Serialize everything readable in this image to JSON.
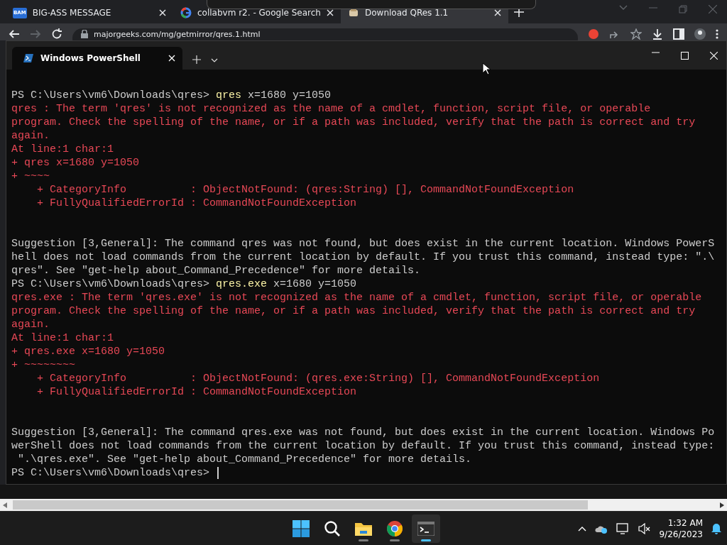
{
  "browser": {
    "tabs": [
      {
        "favicon_text": "BAM",
        "kind": "bam",
        "title": "BIG-ASS MESSAGE",
        "selected": false
      },
      {
        "kind": "google",
        "title": "collabvm r2. - Google Search",
        "selected": false
      },
      {
        "kind": "archive",
        "title": "Download QRes 1.1",
        "selected": true
      }
    ],
    "address": "majorgeeks.com/mg/getmirror/qres.1.html"
  },
  "terminal": {
    "tabs": [
      {
        "title": "Windows PowerShell",
        "selected": true
      }
    ],
    "lines": [
      {
        "kind": "text",
        "segments": [
          {
            "kind": "prompt",
            "text": "PS C:\\Users\\vm6\\Downloads\\qres> "
          },
          {
            "kind": "command",
            "text": "qres"
          },
          {
            "kind": "arg",
            "text": " x=1680 y=1050"
          }
        ]
      },
      {
        "kind": "text",
        "segments": [
          {
            "kind": "error",
            "text": "qres : The term 'qres' is not recognized as the name of a cmdlet, function, script file, or operable"
          }
        ]
      },
      {
        "kind": "text",
        "segments": [
          {
            "kind": "error",
            "text": "program. Check the spelling of the name, or if a path was included, verify that the path is correct and try"
          }
        ]
      },
      {
        "kind": "text",
        "segments": [
          {
            "kind": "error",
            "text": "again."
          }
        ]
      },
      {
        "kind": "text",
        "segments": [
          {
            "kind": "error",
            "text": "At line:1 char:1"
          }
        ]
      },
      {
        "kind": "text",
        "segments": [
          {
            "kind": "error",
            "text": "+ qres x=1680 y=1050"
          }
        ]
      },
      {
        "kind": "text",
        "segments": [
          {
            "kind": "error",
            "text": "+ ~~~~"
          }
        ]
      },
      {
        "kind": "text",
        "segments": [
          {
            "kind": "error",
            "text": "    + CategoryInfo          : ObjectNotFound: (qres:String) [], CommandNotFoundException"
          }
        ]
      },
      {
        "kind": "text",
        "segments": [
          {
            "kind": "error",
            "text": "    + FullyQualifiedErrorId : CommandNotFoundException"
          }
        ]
      },
      {
        "kind": "blank"
      },
      {
        "kind": "blank"
      },
      {
        "kind": "text",
        "segments": [
          {
            "kind": "output",
            "text": "Suggestion [3,General]: The command qres was not found, but does exist in the current location. Windows PowerS"
          }
        ]
      },
      {
        "kind": "text",
        "segments": [
          {
            "kind": "output",
            "text": "hell does not load commands from the current location by default. If you trust this command, instead type: \".\\"
          }
        ]
      },
      {
        "kind": "text",
        "segments": [
          {
            "kind": "output",
            "text": "qres\". See \"get-help about_Command_Precedence\" for more details."
          }
        ]
      },
      {
        "kind": "text",
        "segments": [
          {
            "kind": "prompt",
            "text": "PS C:\\Users\\vm6\\Downloads\\qres> "
          },
          {
            "kind": "command",
            "text": "qres.exe"
          },
          {
            "kind": "arg",
            "text": " x=1680 y=1050"
          }
        ]
      },
      {
        "kind": "text",
        "segments": [
          {
            "kind": "error",
            "text": "qres.exe : The term 'qres.exe' is not recognized as the name of a cmdlet, function, script file, or operable"
          }
        ]
      },
      {
        "kind": "text",
        "segments": [
          {
            "kind": "error",
            "text": "program. Check the spelling of the name, or if a path was included, verify that the path is correct and try"
          }
        ]
      },
      {
        "kind": "text",
        "segments": [
          {
            "kind": "error",
            "text": "again."
          }
        ]
      },
      {
        "kind": "text",
        "segments": [
          {
            "kind": "error",
            "text": "At line:1 char:1"
          }
        ]
      },
      {
        "kind": "text",
        "segments": [
          {
            "kind": "error",
            "text": "+ qres.exe x=1680 y=1050"
          }
        ]
      },
      {
        "kind": "text",
        "segments": [
          {
            "kind": "error",
            "text": "+ ~~~~~~~~"
          }
        ]
      },
      {
        "kind": "text",
        "segments": [
          {
            "kind": "error",
            "text": "    + CategoryInfo          : ObjectNotFound: (qres.exe:String) [], CommandNotFoundException"
          }
        ]
      },
      {
        "kind": "text",
        "segments": [
          {
            "kind": "error",
            "text": "    + FullyQualifiedErrorId : CommandNotFoundException"
          }
        ]
      },
      {
        "kind": "blank"
      },
      {
        "kind": "blank"
      },
      {
        "kind": "text",
        "segments": [
          {
            "kind": "output",
            "text": "Suggestion [3,General]: The command qres.exe was not found, but does exist in the current location. Windows Po"
          }
        ]
      },
      {
        "kind": "text",
        "segments": [
          {
            "kind": "output",
            "text": "werShell does not load commands from the current location by default. If you trust this command, instead type:"
          }
        ]
      },
      {
        "kind": "text",
        "segments": [
          {
            "kind": "output",
            "text": " \".\\qres.exe\". See \"get-help about_Command_Precedence\" for more details."
          }
        ]
      },
      {
        "kind": "text",
        "cursor": true,
        "segments": [
          {
            "kind": "prompt",
            "text": "PS C:\\Users\\vm6\\Downloads\\qres> "
          }
        ]
      }
    ]
  },
  "taskbar": {
    "apps": [
      {
        "kind": "start",
        "active": false
      },
      {
        "kind": "search",
        "active": false
      },
      {
        "kind": "files",
        "active": false
      },
      {
        "kind": "chrome",
        "active": false
      },
      {
        "kind": "terminal",
        "active": true
      }
    ],
    "time": "1:32 AM",
    "date": "9/26/2023"
  }
}
